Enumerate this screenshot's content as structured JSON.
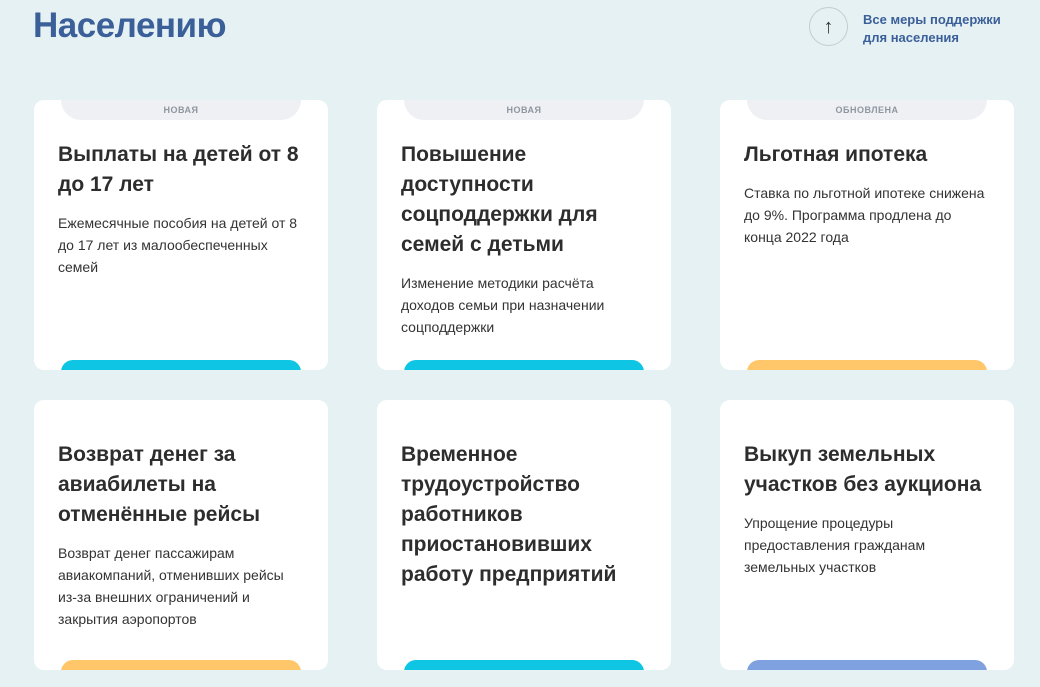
{
  "page": {
    "title": "Населению"
  },
  "all_measures": {
    "label": "Все меры поддержки для населения",
    "icon": "arrow-up-icon"
  },
  "colors": {
    "cyan": "#0ec5e3",
    "orange": "#ffc76a",
    "blue": "#7fa1e0"
  },
  "cards": [
    {
      "badge": "НОВАЯ",
      "title": "Выплаты на детей от 8 до 17 лет",
      "desc": "Ежемесячные пособия на детей от 8 до 17 лет из малообеспеченных семей",
      "bar": "#0ec5e3"
    },
    {
      "badge": "НОВАЯ",
      "title": "Повышение доступности соцподдержки для семей с детьми",
      "desc": "Изменение методики расчёта доходов семьи при назначении соцподдержки",
      "bar": "#0ec5e3"
    },
    {
      "badge": "ОБНОВЛЕНА",
      "title": "Льготная ипотека",
      "desc": "Ставка по льготной ипотеке снижена до 9%. Программа продлена до конца 2022 года",
      "bar": "#ffc76a"
    },
    {
      "badge": "",
      "title": "Возврат денег за авиабилеты на отменённые рейсы",
      "desc": "Возврат денег пассажирам авиакомпаний, отменивших рейсы из-за внешних ограничений и закрытия аэропортов",
      "bar": "#ffc76a"
    },
    {
      "badge": "",
      "title": "Временное трудоустройство работников приостановивших работу предприятий",
      "desc": "",
      "bar": "#0ec5e3"
    },
    {
      "badge": "",
      "title": "Выкуп земельных участков без аукциона",
      "desc": "Упрощение процедуры предоставления гражданам земельных участков",
      "bar": "#7fa1e0"
    }
  ]
}
